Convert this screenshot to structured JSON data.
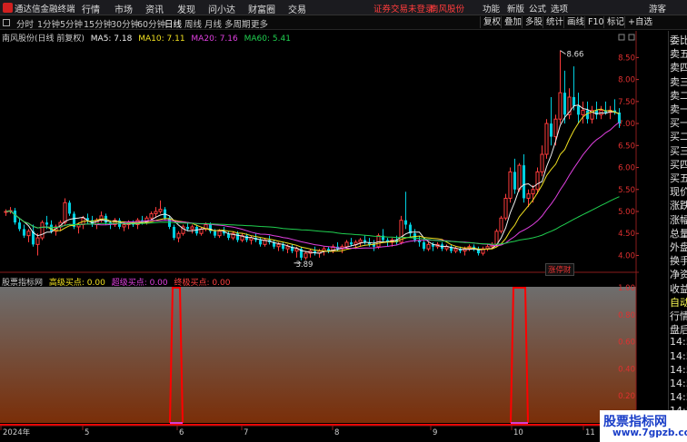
{
  "app": {
    "title": "通达信金融终端"
  },
  "menu": [
    "行情",
    "市场",
    "资讯",
    "发现",
    "问小达",
    "财富圈",
    "交易"
  ],
  "menu_status": {
    "login": "证券交易未登录",
    "stock": "南风股份"
  },
  "menu_right": [
    "功能",
    "新版",
    "公式",
    "选项",
    "游客"
  ],
  "periods": [
    "分时",
    "1分钟",
    "5分钟",
    "15分钟",
    "30分钟",
    "60分钟",
    "日线",
    "周线",
    "月线",
    "多周期",
    "更多"
  ],
  "active_period": "日线",
  "toolbar_buttons": [
    "复权",
    "叠加",
    "多股",
    "统计",
    "画线",
    "F10",
    "标记",
    "+自选"
  ],
  "main_legend": {
    "name": "南风股份(日线 前复权)",
    "ma5": "MA5: 7.18",
    "ma10": "MA10: 7.11",
    "ma20": "MA20: 7.16",
    "ma60": "MA60: 5.41"
  },
  "indicator_legend": {
    "name": "股票指标网",
    "s1": "高级买点: 0.00",
    "s2": "超级买点: 0.00",
    "s3": "终极买点: 0.00"
  },
  "colors": {
    "up": "#ff3c3c",
    "down": "#00d0e0",
    "ma5": "#f0f0f0",
    "ma10": "#f0e020",
    "ma20": "#e040e0",
    "ma60": "#20d050",
    "signal": "#ff0000",
    "bar_top": "#6e6e6e",
    "bar_bottom": "#7a2e08"
  },
  "price_axis": [
    "8.50",
    "8.00",
    "7.50",
    "7.00",
    "6.50",
    "6.00",
    "5.50",
    "5.00",
    "4.50",
    "4.00"
  ],
  "ind_axis": [
    "1.00",
    "0.80",
    "0.60",
    "0.40",
    "0.20"
  ],
  "date_labels": [
    "2024年",
    "5",
    "6",
    "7",
    "8",
    "9",
    "10",
    "11"
  ],
  "annotations": {
    "high": "8.66",
    "low": "3.89"
  },
  "logo_badge": "涨停财",
  "side_panel": [
    "委比",
    "卖五",
    "卖四",
    "卖三",
    "卖二",
    "卖一",
    "买一",
    "买二",
    "买三",
    "买四",
    "买五",
    "现价",
    "涨跌",
    "涨幅",
    "总量",
    "外盘",
    "换手",
    "净资",
    "收益",
    "自动",
    "行情",
    "盘后",
    "14:50",
    "14:50",
    "14:50",
    "14:50",
    "14:50",
    "14:50",
    "14:50"
  ],
  "watermark": {
    "line1": "股票指标网",
    "line2": "www.7gpzb.com"
  },
  "chart_data": {
    "type": "candlestick",
    "price_ylim": [
      3.7,
      8.9
    ],
    "indicator_ylim": [
      0,
      1.0
    ],
    "candles": [
      [
        5.0,
        5.05,
        4.9,
        5.0
      ],
      [
        5.0,
        5.1,
        4.95,
        5.02
      ],
      [
        5.02,
        5.08,
        4.7,
        4.75
      ],
      [
        4.75,
        4.85,
        4.55,
        4.6
      ],
      [
        4.6,
        4.7,
        4.4,
        4.45
      ],
      [
        4.45,
        4.6,
        4.3,
        4.55
      ],
      [
        4.55,
        4.7,
        4.2,
        4.25
      ],
      [
        4.25,
        4.5,
        4.0,
        4.4
      ],
      [
        4.4,
        4.8,
        4.35,
        4.75
      ],
      [
        4.75,
        4.9,
        4.6,
        4.7
      ],
      [
        4.7,
        4.8,
        4.5,
        4.55
      ],
      [
        4.55,
        4.7,
        4.45,
        4.65
      ],
      [
        4.65,
        4.8,
        4.55,
        4.75
      ],
      [
        4.75,
        5.3,
        4.7,
        5.2
      ],
      [
        5.2,
        5.25,
        4.9,
        4.95
      ],
      [
        4.95,
        5.0,
        4.6,
        4.65
      ],
      [
        4.65,
        4.75,
        4.5,
        4.7
      ],
      [
        4.7,
        4.9,
        4.6,
        4.85
      ],
      [
        4.85,
        4.95,
        4.7,
        4.8
      ],
      [
        4.8,
        4.9,
        4.65,
        4.7
      ],
      [
        4.7,
        4.85,
        4.6,
        4.8
      ],
      [
        4.8,
        5.0,
        4.75,
        4.9
      ],
      [
        4.9,
        4.95,
        4.7,
        4.75
      ],
      [
        4.75,
        4.8,
        4.6,
        4.7
      ],
      [
        4.7,
        4.85,
        4.65,
        4.8
      ],
      [
        4.8,
        4.85,
        4.6,
        4.65
      ],
      [
        4.65,
        4.75,
        4.55,
        4.7
      ],
      [
        4.7,
        4.8,
        4.6,
        4.75
      ],
      [
        4.75,
        4.8,
        4.65,
        4.7
      ],
      [
        4.7,
        4.85,
        4.6,
        4.8
      ],
      [
        4.8,
        4.9,
        4.7,
        4.75
      ],
      [
        4.75,
        4.9,
        4.7,
        4.85
      ],
      [
        4.85,
        5.0,
        4.8,
        4.95
      ],
      [
        4.95,
        5.1,
        4.85,
        5.0
      ],
      [
        5.0,
        5.25,
        4.95,
        5.05
      ],
      [
        5.05,
        5.1,
        4.8,
        4.85
      ],
      [
        4.85,
        4.9,
        4.6,
        4.65
      ],
      [
        4.65,
        4.7,
        4.35,
        4.4
      ],
      [
        4.4,
        4.55,
        4.3,
        4.5
      ],
      [
        4.5,
        4.7,
        4.45,
        4.65
      ],
      [
        4.65,
        4.75,
        4.55,
        4.6
      ],
      [
        4.6,
        4.7,
        4.5,
        4.65
      ],
      [
        4.65,
        4.7,
        4.45,
        4.5
      ],
      [
        4.5,
        4.65,
        4.45,
        4.6
      ],
      [
        4.6,
        4.75,
        4.55,
        4.7
      ],
      [
        4.7,
        4.75,
        4.5,
        4.55
      ],
      [
        4.55,
        4.6,
        4.4,
        4.45
      ],
      [
        4.45,
        4.6,
        4.4,
        4.55
      ],
      [
        4.55,
        4.65,
        4.45,
        4.5
      ],
      [
        4.5,
        4.55,
        4.35,
        4.4
      ],
      [
        4.4,
        4.55,
        4.35,
        4.5
      ],
      [
        4.5,
        4.55,
        4.3,
        4.35
      ],
      [
        4.35,
        4.5,
        4.3,
        4.45
      ],
      [
        4.45,
        4.5,
        4.3,
        4.35
      ],
      [
        4.35,
        4.45,
        4.25,
        4.4
      ],
      [
        4.4,
        4.5,
        4.3,
        4.35
      ],
      [
        4.35,
        4.4,
        4.2,
        4.25
      ],
      [
        4.25,
        4.4,
        4.2,
        4.35
      ],
      [
        4.35,
        4.45,
        4.25,
        4.3
      ],
      [
        4.3,
        4.35,
        4.15,
        4.2
      ],
      [
        4.2,
        4.3,
        4.1,
        4.25
      ],
      [
        4.25,
        4.3,
        4.1,
        4.15
      ],
      [
        4.15,
        4.25,
        4.05,
        4.2
      ],
      [
        4.2,
        4.25,
        4.05,
        4.1
      ],
      [
        4.1,
        4.2,
        3.95,
        4.15
      ],
      [
        4.15,
        4.2,
        3.89,
        3.95
      ],
      [
        3.95,
        4.1,
        3.9,
        4.05
      ],
      [
        4.05,
        4.15,
        3.95,
        4.1
      ],
      [
        4.1,
        4.2,
        4.0,
        4.05
      ],
      [
        4.05,
        4.15,
        3.95,
        4.1
      ],
      [
        4.1,
        4.2,
        4.0,
        4.15
      ],
      [
        4.15,
        4.2,
        4.05,
        4.1
      ],
      [
        4.1,
        4.25,
        4.05,
        4.2
      ],
      [
        4.2,
        4.3,
        4.1,
        4.15
      ],
      [
        4.15,
        4.25,
        4.05,
        4.2
      ],
      [
        4.2,
        4.35,
        4.15,
        4.3
      ],
      [
        4.3,
        4.4,
        4.2,
        4.25
      ],
      [
        4.25,
        4.35,
        4.15,
        4.3
      ],
      [
        4.3,
        4.4,
        4.2,
        4.35
      ],
      [
        4.35,
        4.45,
        4.25,
        4.3
      ],
      [
        4.3,
        4.4,
        4.2,
        4.25
      ],
      [
        4.25,
        4.35,
        4.1,
        4.2
      ],
      [
        4.2,
        4.5,
        4.15,
        4.45
      ],
      [
        4.45,
        4.6,
        4.3,
        4.35
      ],
      [
        4.35,
        4.4,
        4.2,
        4.3
      ],
      [
        4.3,
        4.4,
        4.2,
        4.35
      ],
      [
        4.35,
        4.45,
        4.25,
        4.3
      ],
      [
        4.3,
        4.9,
        4.25,
        4.8
      ],
      [
        4.8,
        5.45,
        4.6,
        4.7
      ],
      [
        4.7,
        4.75,
        4.4,
        4.5
      ],
      [
        4.5,
        4.6,
        4.3,
        4.35
      ],
      [
        4.35,
        4.45,
        4.2,
        4.3
      ],
      [
        4.3,
        4.4,
        4.1,
        4.15
      ],
      [
        4.15,
        4.3,
        4.1,
        4.25
      ],
      [
        4.25,
        4.3,
        4.1,
        4.2
      ],
      [
        4.2,
        4.3,
        4.15,
        4.25
      ],
      [
        4.25,
        4.3,
        4.1,
        4.15
      ],
      [
        4.15,
        4.25,
        4.1,
        4.2
      ],
      [
        4.2,
        4.25,
        4.05,
        4.1
      ],
      [
        4.1,
        4.2,
        4.05,
        4.15
      ],
      [
        4.15,
        4.2,
        4.05,
        4.1
      ],
      [
        4.1,
        4.2,
        4.0,
        4.15
      ],
      [
        4.15,
        4.25,
        4.1,
        4.2
      ],
      [
        4.2,
        4.25,
        4.1,
        4.15
      ],
      [
        4.15,
        4.2,
        4.0,
        4.05
      ],
      [
        4.05,
        4.2,
        4.0,
        4.15
      ],
      [
        4.15,
        4.25,
        4.1,
        4.2
      ],
      [
        4.2,
        4.3,
        4.15,
        4.25
      ],
      [
        4.25,
        4.6,
        4.2,
        4.55
      ],
      [
        4.55,
        4.9,
        4.5,
        4.85
      ],
      [
        4.85,
        5.4,
        4.8,
        5.3
      ],
      [
        5.3,
        6.0,
        5.2,
        5.9
      ],
      [
        5.9,
        6.2,
        5.4,
        5.5
      ],
      [
        5.5,
        6.1,
        5.45,
        6.05
      ],
      [
        6.05,
        6.3,
        5.2,
        5.3
      ],
      [
        5.3,
        5.5,
        5.1,
        5.4
      ],
      [
        5.4,
        5.6,
        5.2,
        5.5
      ],
      [
        5.5,
        6.0,
        5.4,
        5.9
      ],
      [
        5.9,
        6.5,
        5.8,
        6.3
      ],
      [
        6.3,
        7.1,
        6.2,
        7.0
      ],
      [
        7.0,
        7.6,
        6.5,
        6.7
      ],
      [
        6.7,
        7.2,
        6.5,
        7.1
      ],
      [
        7.1,
        8.66,
        7.0,
        7.7
      ],
      [
        7.7,
        8.2,
        7.0,
        7.2
      ],
      [
        7.2,
        7.8,
        7.1,
        7.6
      ],
      [
        7.6,
        8.3,
        7.3,
        7.4
      ],
      [
        7.4,
        7.7,
        7.0,
        7.2
      ],
      [
        7.2,
        7.5,
        7.0,
        7.3
      ],
      [
        7.3,
        7.5,
        7.0,
        7.1
      ],
      [
        7.1,
        7.4,
        7.0,
        7.3
      ],
      [
        7.3,
        7.5,
        7.1,
        7.2
      ],
      [
        7.2,
        7.4,
        7.1,
        7.3
      ],
      [
        7.3,
        7.5,
        7.2,
        7.25
      ],
      [
        7.25,
        7.4,
        7.1,
        7.3
      ],
      [
        7.3,
        7.55,
        7.2,
        7.25
      ],
      [
        7.25,
        7.35,
        6.9,
        7.0
      ]
    ],
    "indicator_signals": [
      0,
      0,
      0,
      0,
      0,
      0,
      0,
      0,
      0,
      0,
      0,
      0,
      0,
      0,
      0,
      0,
      0,
      0,
      0,
      0,
      0,
      0,
      0,
      0,
      0,
      0,
      0,
      0,
      0,
      0,
      0,
      0,
      0,
      0,
      0,
      0,
      0,
      1,
      1,
      0,
      0,
      0,
      0,
      0,
      0,
      0,
      0,
      0,
      0,
      0,
      0,
      0,
      0,
      0,
      0,
      0,
      0,
      0,
      0,
      0,
      0,
      0,
      0,
      0,
      0,
      0,
      0,
      0,
      0,
      0,
      0,
      0,
      0,
      0,
      0,
      0,
      0,
      0,
      0,
      0,
      0,
      0,
      0,
      0,
      0,
      0,
      0,
      0,
      0,
      0,
      0,
      0,
      0,
      0,
      0,
      0,
      0,
      0,
      0,
      0,
      0,
      0,
      0,
      0,
      0,
      0,
      0,
      0,
      0,
      0,
      0,
      0,
      1,
      1,
      1,
      0,
      0,
      0,
      0,
      0,
      0,
      0,
      0,
      0,
      0,
      0,
      0,
      0,
      0,
      0,
      0,
      0,
      0,
      0,
      0,
      0,
      0
    ]
  }
}
